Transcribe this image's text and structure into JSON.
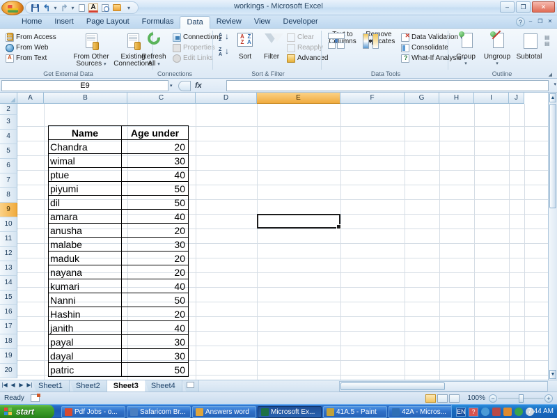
{
  "window": {
    "title": "workings - Microsoft Excel",
    "minimize_label": "–",
    "restore_label": "❐",
    "close_label": "✕"
  },
  "quick_access": [
    {
      "name": "office-orb",
      "label": ""
    },
    {
      "name": "save-icon",
      "label": "Save"
    },
    {
      "name": "undo-icon",
      "label": "Undo"
    },
    {
      "name": "redo-icon",
      "label": "Redo"
    },
    {
      "name": "new-icon",
      "label": "New"
    },
    {
      "name": "font-color-icon",
      "label": "A"
    },
    {
      "name": "print-preview-icon",
      "label": "Print Preview"
    },
    {
      "name": "open-icon",
      "label": "Open"
    },
    {
      "name": "customize-qat-icon",
      "label": "▾"
    }
  ],
  "ribbon": {
    "tabs": [
      {
        "label": "Home",
        "active": false
      },
      {
        "label": "Insert",
        "active": false
      },
      {
        "label": "Page Layout",
        "active": false
      },
      {
        "label": "Formulas",
        "active": false
      },
      {
        "label": "Data",
        "active": true
      },
      {
        "label": "Review",
        "active": false
      },
      {
        "label": "View",
        "active": false
      },
      {
        "label": "Developer",
        "active": false
      }
    ],
    "help_label": "?",
    "groups": {
      "get_external_data": {
        "label": "Get External Data",
        "from_access": "From Access",
        "from_web": "From Web",
        "from_text": "From Text",
        "from_other_sources": "From Other Sources",
        "from_other_sources_l1": "From Other",
        "from_other_sources_l2": "Sources",
        "existing_connections_l1": "Existing",
        "existing_connections_l2": "Connections",
        "dropdown": "▾"
      },
      "connections": {
        "label": "Connections",
        "refresh_all_l1": "Refresh",
        "refresh_all_l2": "All",
        "connections": "Connections",
        "properties": "Properties",
        "edit_links": "Edit Links",
        "dropdown": "▾"
      },
      "sort_filter": {
        "label": "Sort & Filter",
        "sort_az": "A→Z",
        "sort_za": "Z→A",
        "sort": "Sort",
        "filter": "Filter",
        "clear": "Clear",
        "reapply": "Reapply",
        "advanced": "Advanced"
      },
      "data_tools": {
        "label": "Data Tools",
        "text_to_columns_l1": "Text to",
        "text_to_columns_l2": "Columns",
        "remove_duplicates_l1": "Remove",
        "remove_duplicates_l2": "Duplicates",
        "data_validation": "Data Validation",
        "consolidate": "Consolidate",
        "what_if_analysis": "What-If Analysis",
        "dropdown": "▾"
      },
      "outline": {
        "label": "Outline",
        "group": "Group",
        "ungroup": "Ungroup",
        "subtotal": "Subtotal",
        "dropdown": "▾"
      }
    }
  },
  "formula_bar": {
    "name_box_value": "E9",
    "name_box_arrow": "▾",
    "fx_label": "fx",
    "formula_value": "",
    "expand_arrow": "▾"
  },
  "grid": {
    "columns": [
      "A",
      "B",
      "C",
      "D",
      "E",
      "F",
      "G",
      "H",
      "I",
      "J"
    ],
    "selected_column": "E",
    "rows": [
      2,
      3,
      4,
      5,
      6,
      7,
      8,
      9,
      10,
      11,
      12,
      13,
      14,
      15,
      16,
      17,
      18,
      19,
      20
    ],
    "selected_row": 9,
    "active_cell": "E9",
    "table": {
      "headers": [
        "Name",
        "Age under"
      ],
      "rows": [
        [
          "Chandra",
          "20"
        ],
        [
          "wimal",
          "30"
        ],
        [
          "ptue",
          "40"
        ],
        [
          "piyumi",
          "50"
        ],
        [
          "dil",
          "50"
        ],
        [
          "amara",
          "40"
        ],
        [
          "anusha",
          "20"
        ],
        [
          "malabe",
          "30"
        ],
        [
          "maduk",
          "20"
        ],
        [
          "nayana",
          "20"
        ],
        [
          "kumari",
          "40"
        ],
        [
          "Nanni",
          "50"
        ],
        [
          "Hashin",
          "20"
        ],
        [
          "janith",
          "40"
        ],
        [
          "payal",
          "30"
        ],
        [
          "dayal",
          "30"
        ],
        [
          "patric",
          "50"
        ]
      ]
    },
    "scroll_up_arrow": "▲",
    "scroll_down_arrow": "▼"
  },
  "sheet_tabs": {
    "nav_first": "|◀",
    "nav_prev": "◀",
    "nav_next": "▶",
    "nav_last": "▶|",
    "tabs": [
      {
        "label": "Sheet1",
        "active": false
      },
      {
        "label": "Sheet2",
        "active": false
      },
      {
        "label": "Sheet3",
        "active": true
      },
      {
        "label": "Sheet4",
        "active": false
      }
    ],
    "new_sheet_label": ""
  },
  "status_bar": {
    "status": "Ready",
    "zoom": "100%",
    "zoom_out": "−",
    "zoom_in": "+",
    "view_normal": "Normal",
    "view_page_layout": "Page Layout",
    "view_page_break": "Page Break Preview"
  },
  "taskbar": {
    "start_label": "start",
    "items": [
      {
        "label": "Pdf Jobs - o...",
        "active": false,
        "icon_color": "#d84a2e"
      },
      {
        "label": "Safaricom Br...",
        "active": false,
        "icon_color": "#4a7fc1"
      },
      {
        "label": "Answers word",
        "active": false,
        "icon_color": "#e0a53a"
      },
      {
        "label": "Microsoft Ex...",
        "active": true,
        "icon_color": "#1d7044"
      },
      {
        "label": "41A.5 - Paint",
        "active": false,
        "icon_color": "#c2a23a"
      },
      {
        "label": "42A - Micros...",
        "active": false,
        "icon_color": "#2f6fb5"
      }
    ],
    "language": "EN",
    "help_tray": "?",
    "clock": "7:44 AM"
  },
  "colors": {
    "accent_orange": "#f0ab3e",
    "ribbon_blue": "#cfe0ef",
    "taskbar_blue": "#1c5ab4",
    "start_green": "#49a832"
  }
}
